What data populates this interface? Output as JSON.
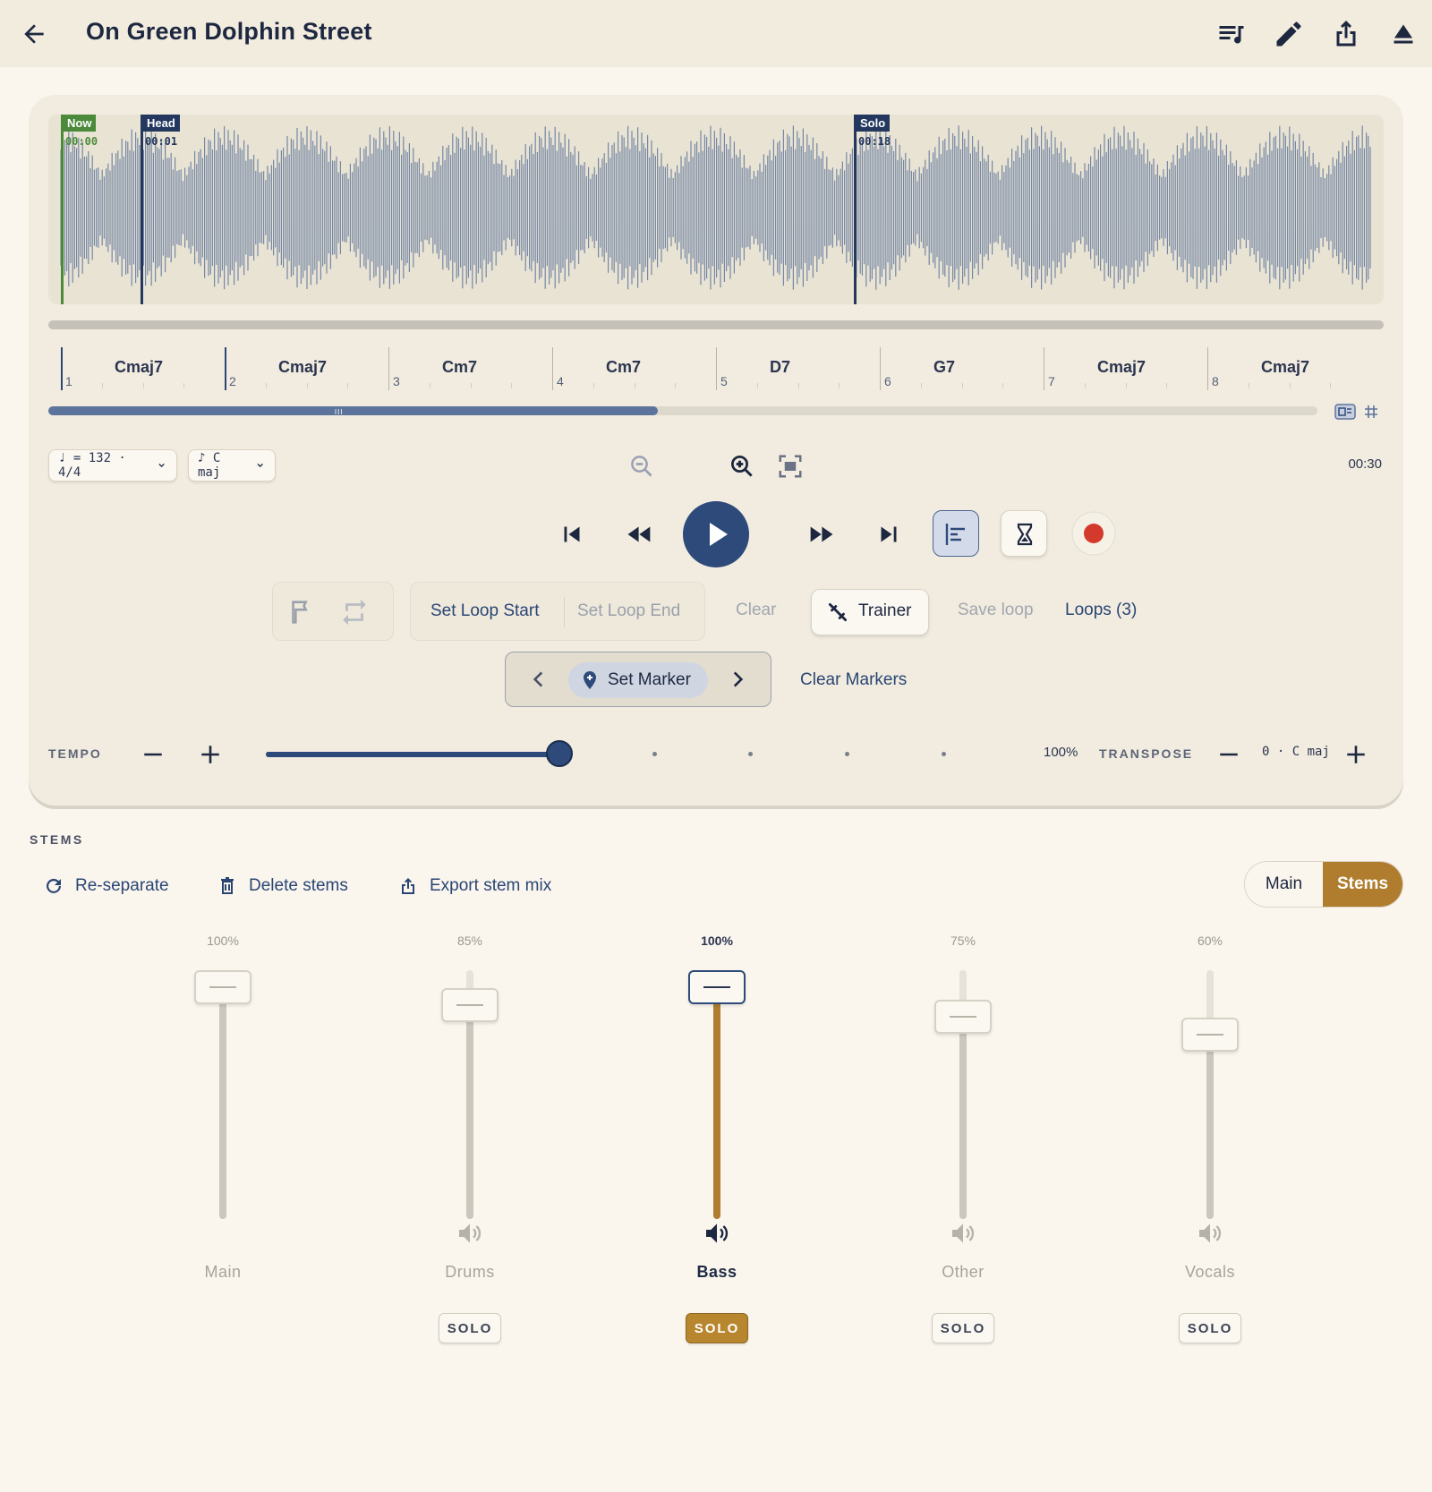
{
  "header": {
    "title": "On Green Dolphin Street"
  },
  "waveform": {
    "markers": [
      {
        "label": "Now",
        "time": "00:00",
        "color": "#4a8a3a"
      },
      {
        "label": "Head",
        "time": "00:01",
        "color": "#24385f"
      },
      {
        "label": "Solo",
        "time": "00:18",
        "color": "#24385f"
      }
    ]
  },
  "chord_track": {
    "bars": [
      {
        "num": "1",
        "chord": "Cmaj7"
      },
      {
        "num": "2",
        "chord": "Cmaj7"
      },
      {
        "num": "3",
        "chord": "Cm7"
      },
      {
        "num": "4",
        "chord": "Cm7"
      },
      {
        "num": "5",
        "chord": "D7"
      },
      {
        "num": "6",
        "chord": "G7"
      },
      {
        "num": "7",
        "chord": "Cmaj7"
      },
      {
        "num": "8",
        "chord": "Cmaj7"
      }
    ],
    "progress": 0.48,
    "progress_grip": "III"
  },
  "toolbar": {
    "tempo_pill": "♩ = 132 · 4/4",
    "key_pill": "♪ C maj",
    "duration": "00:30"
  },
  "loop_controls": {
    "set_loop_start": "Set Loop Start",
    "set_loop_end": "Set Loop End",
    "clear": "Clear",
    "trainer": "Trainer",
    "save_loop": "Save loop",
    "loops": "Loops (3)"
  },
  "marker_controls": {
    "set_marker": "Set Marker",
    "clear_markers": "Clear Markers"
  },
  "tempo": {
    "label": "TEMPO",
    "value": "100%",
    "level": 0.4
  },
  "transpose": {
    "label": "TRANSPOSE",
    "value": "0 · C maj"
  },
  "stems": {
    "label": "STEMS",
    "actions": {
      "reseparate": "Re-separate",
      "delete": "Delete stems",
      "export": "Export stem mix"
    },
    "view_toggle": {
      "main": "Main",
      "stems": "Stems"
    },
    "solo_label": "SOLO",
    "channels": [
      {
        "name": "Main",
        "volume": "100%",
        "level": 1.0,
        "active": false,
        "solo": false
      },
      {
        "name": "Drums",
        "volume": "85%",
        "level": 0.85,
        "active": false,
        "solo": true
      },
      {
        "name": "Bass",
        "volume": "100%",
        "level": 1.0,
        "active": true,
        "solo": true
      },
      {
        "name": "Other",
        "volume": "75%",
        "level": 0.75,
        "active": false,
        "solo": true
      },
      {
        "name": "Vocals",
        "volume": "60%",
        "level": 0.6,
        "active": false,
        "solo": true
      }
    ]
  },
  "colors": {
    "accent": "#2e4a7a",
    "stems_accent": "#b8862e",
    "record": "#d33a2c"
  }
}
